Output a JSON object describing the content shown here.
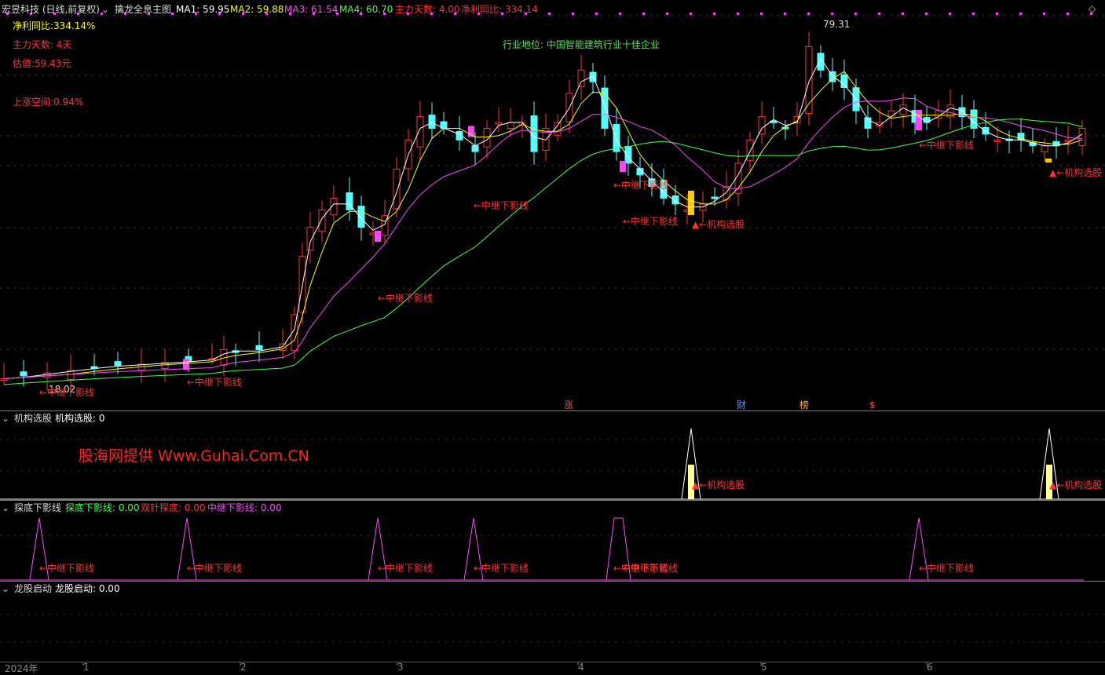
{
  "main_header": {
    "stock": "宏昱科技 (日线,前复权)",
    "indicator": "擒龙全息主图",
    "ma": [
      {
        "label": "MA1: 59.95",
        "color": "#ffffff"
      },
      {
        "label": "MA2: 59.88",
        "color": "#ffff00"
      },
      {
        "label": "MA3: 61.54",
        "color": "#ff44ff"
      },
      {
        "label": "MA4: 60.70",
        "color": "#44ff44"
      },
      {
        "label": "主力天数: 4.00",
        "color": "#ff3333"
      },
      {
        "label": "净利同比: 334.14",
        "color": "#ff3333"
      }
    ]
  },
  "left_info": {
    "net_profit": "净利同比:334.14%",
    "main_days": "主力天数: 4天",
    "valuation": "估值:59.43元",
    "upside": "上涨空间:0.94%"
  },
  "industry": "行业地位: 中国智能建筑行业十佳企业",
  "price_marks": {
    "high": "79.31",
    "low": "18.02"
  },
  "annotations": {
    "shadow": "←中继下影线",
    "pick": "▲←机构选股"
  },
  "event_tags": [
    "涨",
    "财",
    "榜",
    "$"
  ],
  "panel1": {
    "title": "机构选股",
    "value": "机构选股: 0",
    "watermark": "股海网提供 Www.Guhai.Com.CN",
    "marker": "▲←机构选股"
  },
  "panel2": {
    "title": "探底下影线",
    "v1": "探底下影线: 0.00",
    "v2": "双针探底: 0.00",
    "v3": "中继下影线: 0.00",
    "marker": "←中继下影线"
  },
  "panel3": {
    "title": "龙股启动",
    "value": "龙股启动: 0.00"
  },
  "dates": [
    "2024年",
    "1",
    "2",
    "3",
    "4",
    "5",
    "6"
  ],
  "colors": {
    "up": "#ff3333",
    "down": "#54ffff",
    "ma1": "#ffffff",
    "ma2": "#ffff00",
    "ma3": "#ff44ff",
    "ma4": "#44ff44",
    "pink": "#ff44ff"
  }
}
